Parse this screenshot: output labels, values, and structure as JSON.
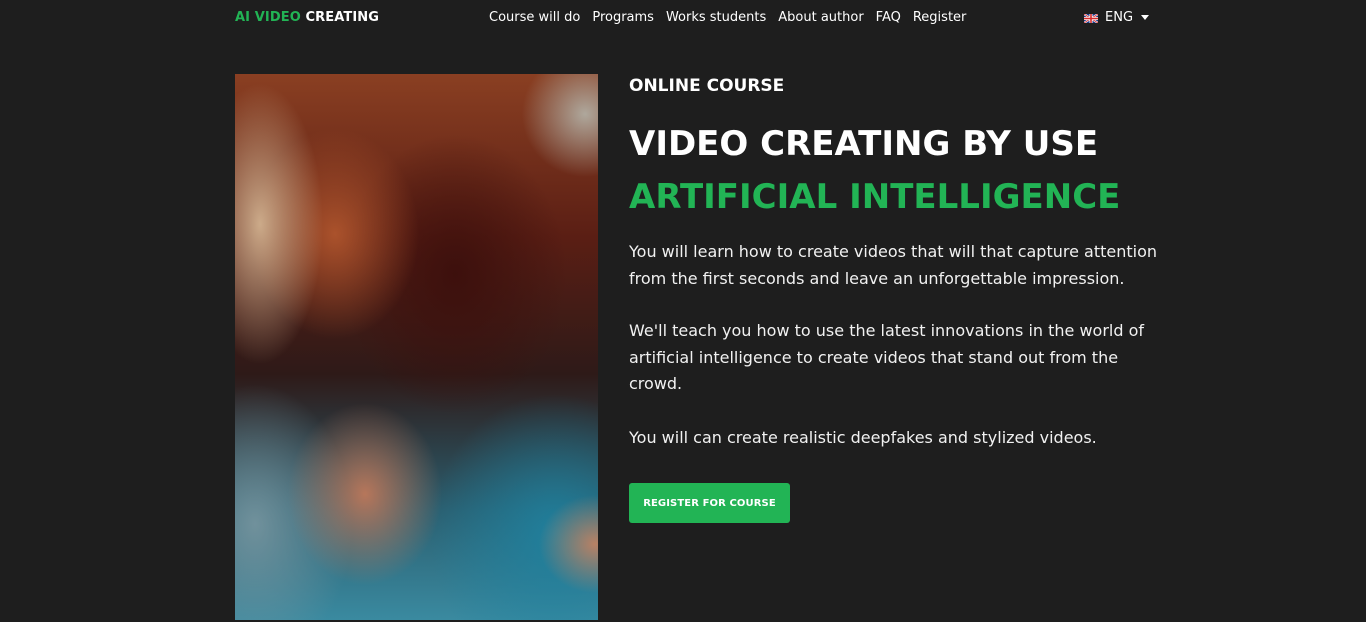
{
  "header": {
    "logo_accent": "AI VIDEO",
    "logo_rest": "CREATING",
    "nav": [
      {
        "label": "Course will do"
      },
      {
        "label": "Programs"
      },
      {
        "label": "Works students"
      },
      {
        "label": "About author"
      },
      {
        "label": "FAQ"
      },
      {
        "label": "Register"
      }
    ],
    "language": {
      "label": "ENG",
      "flag_icon": "uk-flag-icon",
      "caret_icon": "caret-down-icon"
    }
  },
  "hero": {
    "image_description_icon": "hero-photo",
    "eyebrow": "ONLINE COURSE",
    "title_line1": "VIDEO CREATING BY USE",
    "title_line2": "ARTIFICIAL INTELLIGENCE",
    "paragraphs": [
      "You will learn how to create videos that will that capture attention from the first seconds and leave an unforgettable impression.",
      "We'll teach you how to use the latest innovations in the world of artificial intelligence to create videos that stand out from the crowd.",
      "You will can create realistic deepfakes and stylized videos."
    ],
    "cta_label": "REGISTER FOR COURSE"
  },
  "colors": {
    "background": "#1e1e1e",
    "accent": "#22b455",
    "text": "#ffffff"
  }
}
